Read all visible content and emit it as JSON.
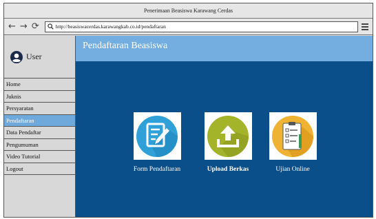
{
  "window": {
    "title": "Penerimaan Beasiswa Karawang Cerdas"
  },
  "browser": {
    "url": "http://beasiswacerdas.karawangkab.co.id/pendaftaran"
  },
  "sidebar": {
    "user_label": "User",
    "items": [
      {
        "label": "Home"
      },
      {
        "label": "Juknis"
      },
      {
        "label": "Persyaratan"
      },
      {
        "label": "Pendaftaran",
        "active": true
      },
      {
        "label": "Data Pendaftar"
      },
      {
        "label": "Pengumuman"
      },
      {
        "label": "Video Tutorial"
      },
      {
        "label": "Logout"
      }
    ]
  },
  "main": {
    "title": "Pendaftaran Beasiswa",
    "tiles": [
      {
        "label": "Form Pendaftaran",
        "icon": "form-edit-icon",
        "color": "#2fa0d8"
      },
      {
        "label": "Upload Berkas",
        "icon": "upload-icon",
        "color": "#a3b32a"
      },
      {
        "label": "Ujian Online",
        "icon": "clipboard-checklist-icon",
        "color": "#f0b233"
      }
    ]
  },
  "colors": {
    "main_bg": "#0a4f8a",
    "header_bg": "#74aee0",
    "active_item": "#6fa9dc"
  }
}
